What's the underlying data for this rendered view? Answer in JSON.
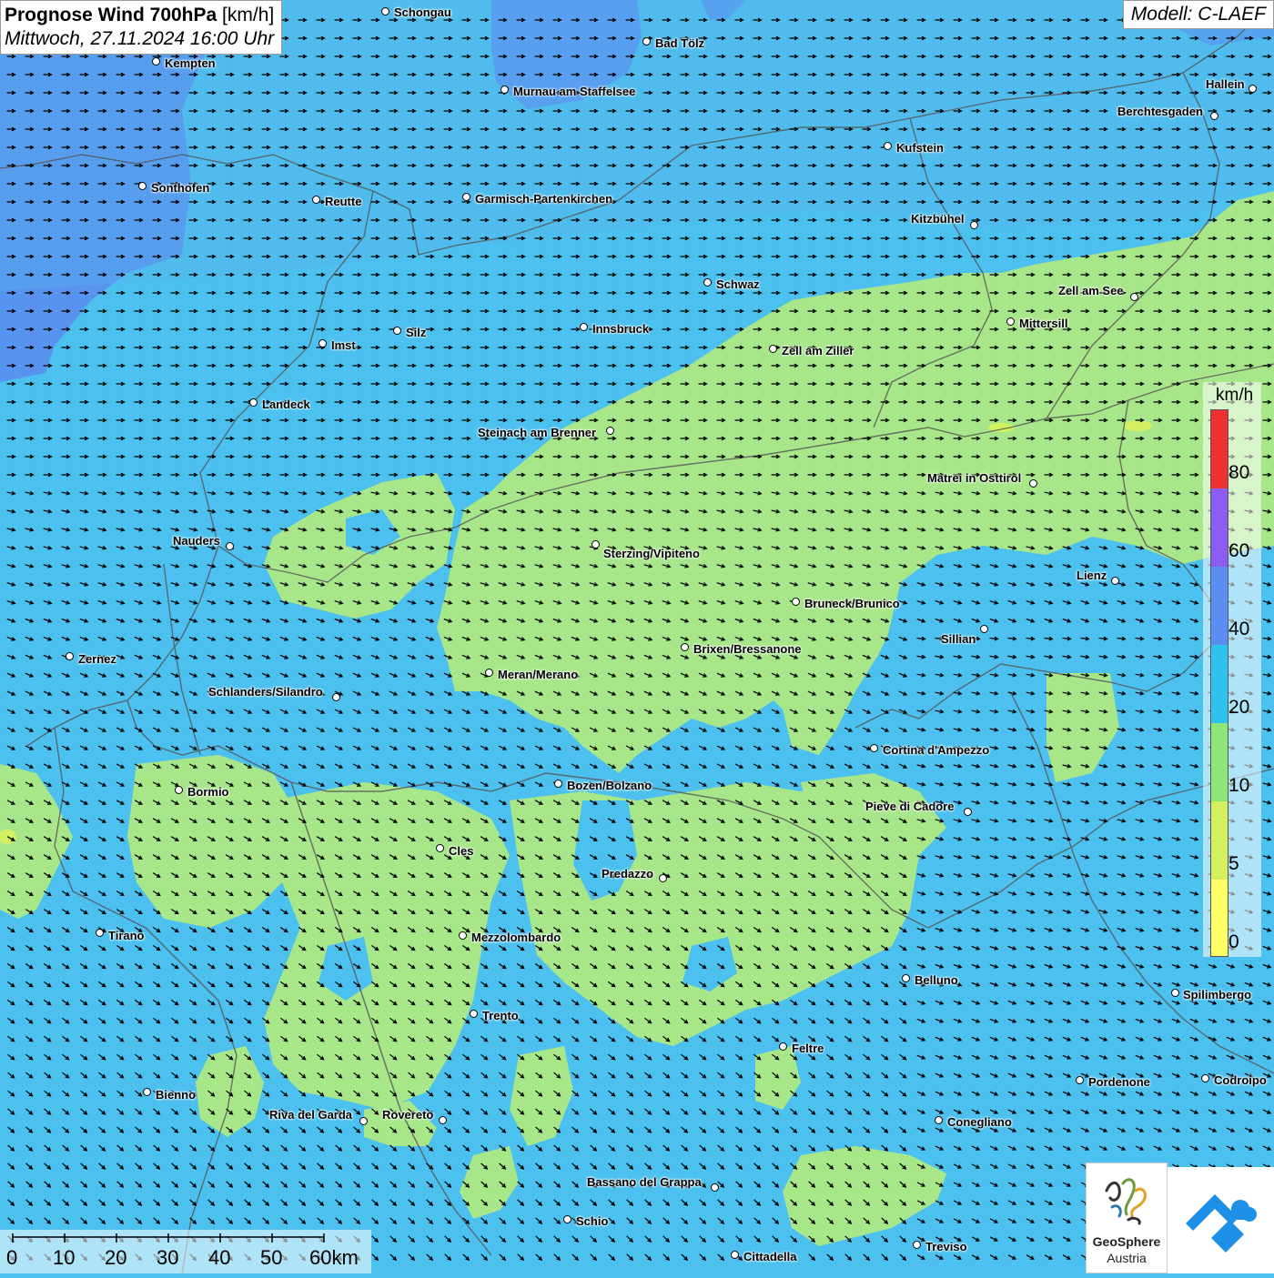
{
  "header": {
    "title_bold": "Prognose Wind 700hPa",
    "title_unit": " [km/h]",
    "datetime": "Mittwoch, 27.11.2024 16:00 Uhr"
  },
  "model": "Modell: C-LAEF",
  "colors": {
    "ocean": "#4cc0ef",
    "light_green": "#a8e68a",
    "blue_high": "#5a8ef0",
    "purple": "#8a5cf0",
    "red": "#f03030",
    "yellow": "#ffff66",
    "lime": "#d4f060"
  },
  "cities": [
    {
      "name": "Schongau",
      "dot": [
        424,
        13
      ],
      "lab": [
        433,
        6
      ]
    },
    {
      "name": "Bad Tölz",
      "dot": [
        711,
        46
      ],
      "lab": [
        720,
        40
      ]
    },
    {
      "name": "Kempten",
      "dot": [
        172,
        68
      ],
      "lab": [
        181,
        62
      ]
    },
    {
      "name": "Murnau am Staffelsee",
      "dot": [
        555,
        99
      ],
      "lab": [
        564,
        93
      ]
    },
    {
      "name": "Hallein",
      "dot": [
        1377,
        98
      ],
      "lab": [
        1325,
        85
      ]
    },
    {
      "name": "Berchtesgaden",
      "dot": [
        1335,
        128
      ],
      "lab": [
        1228,
        115
      ]
    },
    {
      "name": "Kufstein",
      "dot": [
        976,
        161
      ],
      "lab": [
        985,
        155
      ]
    },
    {
      "name": "Sonthofen",
      "dot": [
        157,
        205
      ],
      "lab": [
        166,
        199
      ]
    },
    {
      "name": "Reutte",
      "dot": [
        348,
        220
      ],
      "lab": [
        357,
        214
      ]
    },
    {
      "name": "Garmisch-Partenkirchen",
      "dot": [
        513,
        217
      ],
      "lab": [
        522,
        211
      ]
    },
    {
      "name": "Kitzbühel",
      "dot": [
        1071,
        248
      ],
      "lab": [
        1001,
        233
      ]
    },
    {
      "name": "Schwaz",
      "dot": [
        778,
        311
      ],
      "lab": [
        787,
        305
      ]
    },
    {
      "name": "Zell am See",
      "dot": [
        1247,
        327
      ],
      "lab": [
        1163,
        312
      ]
    },
    {
      "name": "Mittersill",
      "dot": [
        1111,
        354
      ],
      "lab": [
        1120,
        348
      ]
    },
    {
      "name": "Innsbruck",
      "dot": [
        642,
        360
      ],
      "lab": [
        651,
        354
      ]
    },
    {
      "name": "Silz",
      "dot": [
        437,
        364
      ],
      "lab": [
        446,
        358
      ]
    },
    {
      "name": "Imst",
      "dot": [
        355,
        378
      ],
      "lab": [
        364,
        372
      ]
    },
    {
      "name": "Zell am Ziller",
      "dot": [
        850,
        384
      ],
      "lab": [
        859,
        378
      ]
    },
    {
      "name": "Landeck",
      "dot": [
        279,
        443
      ],
      "lab": [
        288,
        437
      ]
    },
    {
      "name": "Steinach am Brenner",
      "dot": [
        671,
        474
      ],
      "lab": [
        525,
        468
      ]
    },
    {
      "name": "Matrei in Osttirol",
      "dot": [
        1136,
        532
      ],
      "lab": [
        1019,
        518
      ]
    },
    {
      "name": "Nauders",
      "dot": [
        253,
        601
      ],
      "lab": [
        190,
        587
      ]
    },
    {
      "name": "Sterzing/Vipiteno",
      "dot": [
        655,
        599
      ],
      "lab": [
        663,
        601
      ]
    },
    {
      "name": "Lienz",
      "dot": [
        1226,
        639
      ],
      "lab": [
        1183,
        625
      ]
    },
    {
      "name": "Bruneck/Brunico",
      "dot": [
        875,
        662
      ],
      "lab": [
        884,
        656
      ]
    },
    {
      "name": "Sillian",
      "dot": [
        1082,
        692
      ],
      "lab": [
        1034,
        695
      ]
    },
    {
      "name": "Brixen/Bressanone",
      "dot": [
        753,
        712
      ],
      "lab": [
        762,
        706
      ]
    },
    {
      "name": "Zernez",
      "dot": [
        77,
        722
      ],
      "lab": [
        86,
        717
      ]
    },
    {
      "name": "Meran/Merano",
      "dot": [
        538,
        740
      ],
      "lab": [
        547,
        734
      ]
    },
    {
      "name": "Schlanders/Silandro",
      "dot": [
        370,
        767
      ],
      "lab": [
        229,
        753
      ]
    },
    {
      "name": "Cortina d'Ampezzo",
      "dot": [
        961,
        823
      ],
      "lab": [
        970,
        817
      ]
    },
    {
      "name": "Bozen/Bolzano",
      "dot": [
        614,
        862
      ],
      "lab": [
        623,
        856
      ]
    },
    {
      "name": "Bormio",
      "dot": [
        197,
        869
      ],
      "lab": [
        206,
        863
      ]
    },
    {
      "name": "Pieve di Cadore",
      "dot": [
        1064,
        893
      ],
      "lab": [
        951,
        879
      ]
    },
    {
      "name": "Cles",
      "dot": [
        484,
        933
      ],
      "lab": [
        493,
        928
      ]
    },
    {
      "name": "Predazzo",
      "dot": [
        729,
        966
      ],
      "lab": [
        661,
        953
      ]
    },
    {
      "name": "Tirano",
      "dot": [
        110,
        1026
      ],
      "lab": [
        119,
        1021
      ]
    },
    {
      "name": "Mezzolombardo",
      "dot": [
        509,
        1029
      ],
      "lab": [
        518,
        1023
      ]
    },
    {
      "name": "Belluno",
      "dot": [
        996,
        1076
      ],
      "lab": [
        1005,
        1070
      ]
    },
    {
      "name": "Spilimbergo",
      "dot": [
        1292,
        1092
      ],
      "lab": [
        1300,
        1086
      ]
    },
    {
      "name": "Trento",
      "dot": [
        521,
        1115
      ],
      "lab": [
        530,
        1109
      ]
    },
    {
      "name": "Feltre",
      "dot": [
        861,
        1151
      ],
      "lab": [
        870,
        1145
      ]
    },
    {
      "name": "Pordenone",
      "dot": [
        1187,
        1188
      ],
      "lab": [
        1196,
        1182
      ]
    },
    {
      "name": "Codroipo",
      "dot": [
        1325,
        1186
      ],
      "lab": [
        1334,
        1180
      ]
    },
    {
      "name": "Bienno",
      "dot": [
        162,
        1201
      ],
      "lab": [
        171,
        1196
      ]
    },
    {
      "name": "Riva del Garda",
      "dot": [
        400,
        1233
      ],
      "lab": [
        296,
        1218
      ]
    },
    {
      "name": "Rovereto",
      "dot": [
        487,
        1232
      ],
      "lab": [
        420,
        1218
      ]
    },
    {
      "name": "Conegliano",
      "dot": [
        1032,
        1232
      ],
      "lab": [
        1041,
        1226
      ]
    },
    {
      "name": "Bassano del Grappa",
      "dot": [
        786,
        1306
      ],
      "lab": [
        645,
        1292
      ]
    },
    {
      "name": "Schio",
      "dot": [
        624,
        1341
      ],
      "lab": [
        633,
        1335
      ]
    },
    {
      "name": "Treviso",
      "dot": [
        1008,
        1369
      ],
      "lab": [
        1017,
        1363
      ]
    },
    {
      "name": "Cittadella",
      "dot": [
        808,
        1380
      ],
      "lab": [
        817,
        1374
      ]
    }
  ],
  "legend": {
    "unit": "km/h",
    "labels": [
      "80",
      "60",
      "40",
      "20",
      "10",
      "5",
      "0"
    ]
  },
  "scale": {
    "labels": [
      "0",
      "10",
      "20",
      "30",
      "40",
      "50",
      "60km"
    ]
  },
  "logo": {
    "line1": "GeoSphere",
    "line2": "Austria"
  }
}
